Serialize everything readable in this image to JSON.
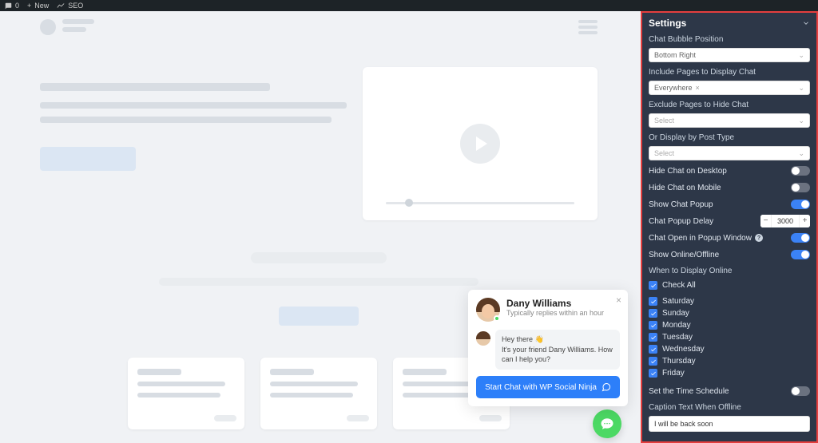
{
  "adminBar": {
    "commentsCount": "0",
    "newLabel": "New",
    "seoLabel": "SEO"
  },
  "chat": {
    "agentName": "Dany Williams",
    "subtitle": "Typically replies within an hour",
    "greeting": "Hey there 👋",
    "body": "It's your friend Dany Williams. How can I help you?",
    "startButton": "Start Chat with WP Social Ninja"
  },
  "settings": {
    "title": "Settings",
    "bubblePosition": {
      "label": "Chat Bubble Position",
      "value": "Bottom Right"
    },
    "includePages": {
      "label": "Include Pages to Display Chat",
      "value": "Everywhere"
    },
    "excludePages": {
      "label": "Exclude Pages to Hide Chat",
      "placeholder": "Select"
    },
    "postType": {
      "label": "Or Display by Post Type",
      "placeholder": "Select"
    },
    "toggles": {
      "hideDesktop": {
        "label": "Hide Chat on Desktop",
        "on": false
      },
      "hideMobile": {
        "label": "Hide Chat on Mobile",
        "on": false
      },
      "showPopup": {
        "label": "Show Chat Popup",
        "on": true
      },
      "popupDelay": {
        "label": "Chat Popup Delay",
        "value": "3000"
      },
      "openWindow": {
        "label": "Chat Open in Popup Window",
        "on": true
      },
      "showOnline": {
        "label": "Show Online/Offline",
        "on": true
      },
      "timeSchedule": {
        "label": "Set the Time Schedule",
        "on": false
      }
    },
    "whenOnline": {
      "label": "When to Display Online",
      "checkAll": "Check All",
      "days": [
        "Saturday",
        "Sunday",
        "Monday",
        "Tuesday",
        "Wednesday",
        "Thursday",
        "Friday"
      ]
    },
    "captionOffline": {
      "label": "Caption Text When Offline",
      "value": "I will be back soon"
    }
  }
}
